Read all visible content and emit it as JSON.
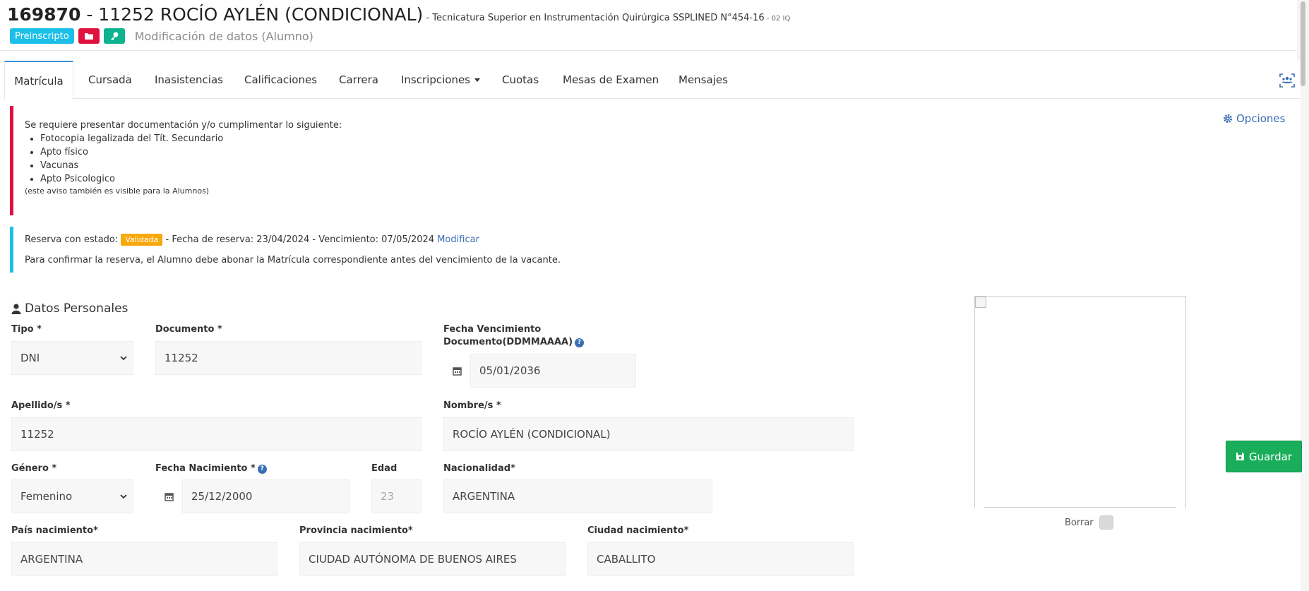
{
  "header": {
    "id": "169870",
    "separator": " - ",
    "name": "11252 ROCÍO AYLÉN (CONDICIONAL)",
    "career": " - Tecnicatura Superior en Instrumentación Quirúrgica SSPLINED N°454-16",
    "career_code": " - 02 IQ",
    "status_badge": "Preinscripto",
    "subtitle": "Modificación de datos (Alumno)"
  },
  "tabs": [
    {
      "label": "Matrícula",
      "active": true
    },
    {
      "label": "Cursada"
    },
    {
      "label": "Inasistencias"
    },
    {
      "label": "Calificaciones"
    },
    {
      "label": "Carrera"
    },
    {
      "label": "Inscripciones",
      "dropdown": true
    },
    {
      "label": "Cuotas"
    },
    {
      "label": "Mesas de Examen"
    },
    {
      "label": "Mensajes"
    }
  ],
  "options_label": "Opciones",
  "alert_docs": {
    "intro": "Se requiere presentar documentación y/o cumplimentar lo siguiente:",
    "items": [
      "Fotocopia legalizada del Tít. Secundario",
      "Apto físico",
      "Vacunas",
      "Apto Psicologico"
    ],
    "note": "(este aviso también es visible para la Alumnos)"
  },
  "reservation": {
    "prefix": "Reserva con estado:",
    "status": "Validada",
    "details": " - Fecha de reserva: 23/04/2024 - Vencimiento: 07/05/2024 ",
    "modify_link": "Modificar",
    "note": "Para confirmar la reserva, el Alumno debe abonar la Matrícula correspondiente antes del vencimiento de la vacante."
  },
  "personal": {
    "section_title": "Datos Personales",
    "tipo": {
      "label": "Tipo *",
      "value": "DNI"
    },
    "documento": {
      "label": "Documento *",
      "value": "11252"
    },
    "vencimiento": {
      "label_1": "Fecha Vencimiento",
      "label_2": "Documento(DDMMAAAA)",
      "value": "05/01/2036"
    },
    "apellido": {
      "label": "Apellido/s *",
      "value": "11252"
    },
    "nombre": {
      "label": "Nombre/s *",
      "value": "ROCÍO AYLÉN (CONDICIONAL)"
    },
    "genero": {
      "label": "Género *",
      "value": "Femenino"
    },
    "nacimiento": {
      "label": "Fecha Nacimiento *",
      "value": "25/12/2000"
    },
    "edad": {
      "label": "Edad",
      "value": "23"
    },
    "nacionalidad": {
      "label": "Nacionalidad*",
      "value": "ARGENTINA"
    },
    "pais": {
      "label": "País nacimiento*",
      "value": "ARGENTINA"
    },
    "provincia": {
      "label": "Provincia nacimiento*",
      "value": "CIUDAD AUTÓNOMA DE BUENOS AIRES"
    },
    "ciudad": {
      "label": "Ciudad nacimiento*",
      "value": "CABALLITO"
    }
  },
  "photo": {
    "delete_label": "Borrar"
  },
  "save_label": "Guardar",
  "colors": {
    "primary": "#3a6fb5",
    "danger": "#e0113f",
    "info": "#1bbfe8",
    "success": "#1aae5b",
    "warning": "#f7a80b"
  }
}
